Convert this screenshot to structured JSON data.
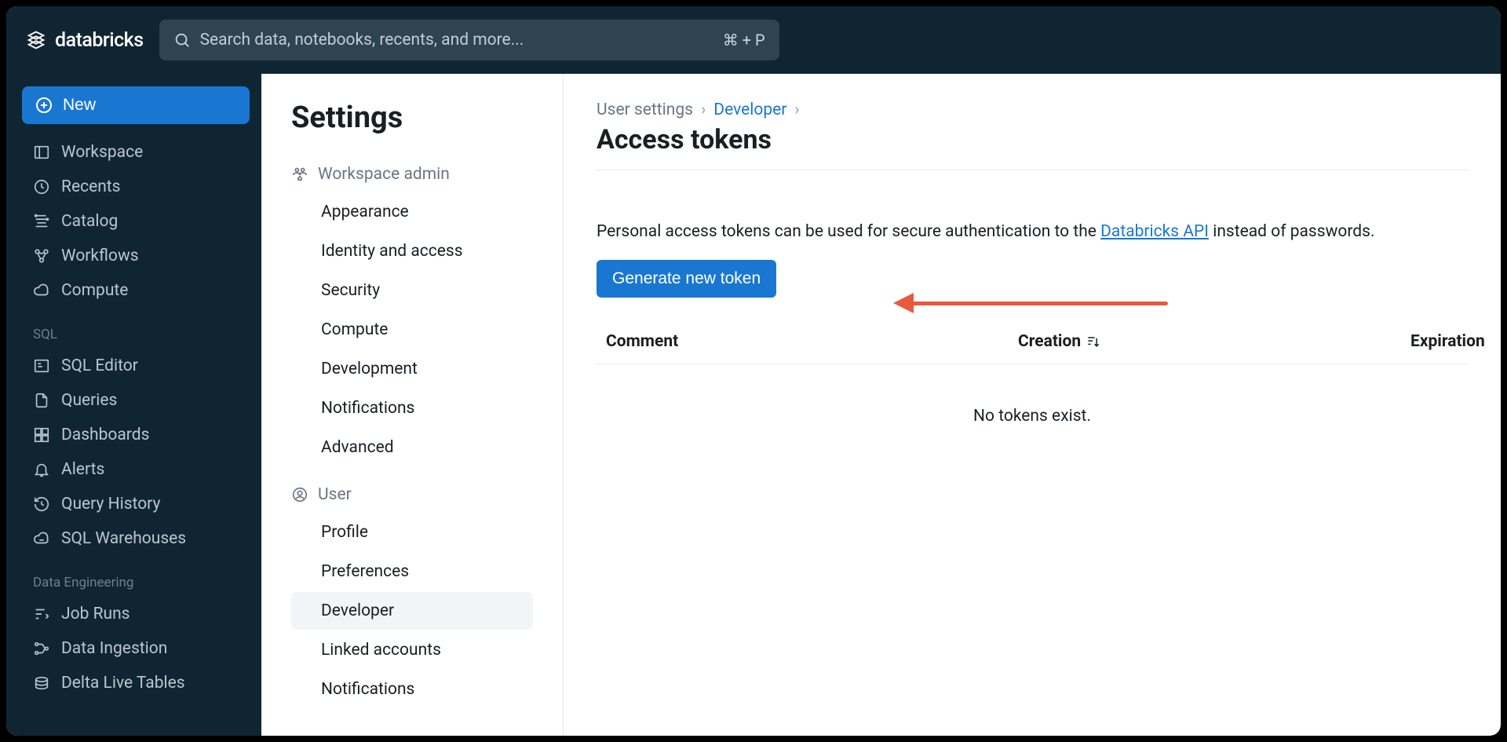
{
  "brand": "databricks",
  "search": {
    "placeholder": "Search data, notebooks, recents, and more...",
    "shortcut": "⌘ + P"
  },
  "sidebar": {
    "new_label": "New",
    "primary": [
      {
        "label": "Workspace"
      },
      {
        "label": "Recents"
      },
      {
        "label": "Catalog"
      },
      {
        "label": "Workflows"
      },
      {
        "label": "Compute"
      }
    ],
    "sql_label": "SQL",
    "sql": [
      {
        "label": "SQL Editor"
      },
      {
        "label": "Queries"
      },
      {
        "label": "Dashboards"
      },
      {
        "label": "Alerts"
      },
      {
        "label": "Query History"
      },
      {
        "label": "SQL Warehouses"
      }
    ],
    "de_label": "Data Engineering",
    "de": [
      {
        "label": "Job Runs"
      },
      {
        "label": "Data Ingestion"
      },
      {
        "label": "Delta Live Tables"
      }
    ]
  },
  "settings": {
    "title": "Settings",
    "admin_label": "Workspace admin",
    "admin_items": [
      "Appearance",
      "Identity and access",
      "Security",
      "Compute",
      "Development",
      "Notifications",
      "Advanced"
    ],
    "user_label": "User",
    "user_items": [
      "Profile",
      "Preferences",
      "Developer",
      "Linked accounts",
      "Notifications"
    ],
    "active_user_item": "Developer"
  },
  "main": {
    "breadcrumb": {
      "root": "User settings",
      "link": "Developer"
    },
    "page_title": "Access tokens",
    "description_prefix": "Personal access tokens can be used for secure authentication to the ",
    "description_link": "Databricks API",
    "description_suffix": " instead of passwords.",
    "generate_button": "Generate new token",
    "columns": {
      "comment": "Comment",
      "creation": "Creation",
      "expiration": "Expiration"
    },
    "empty": "No tokens exist."
  }
}
